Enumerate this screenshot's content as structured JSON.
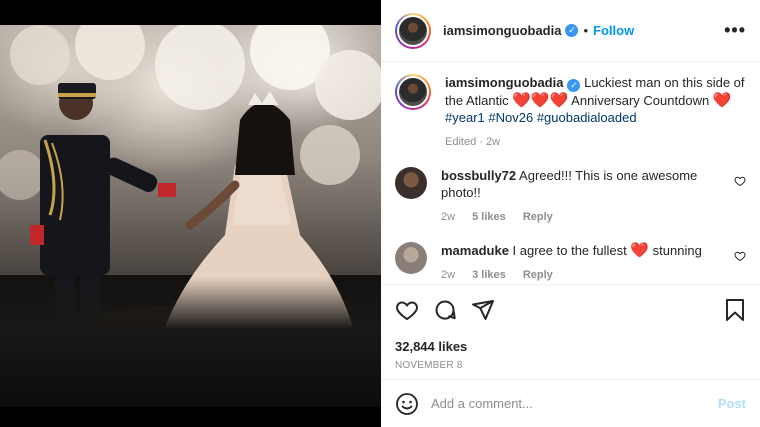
{
  "post": {
    "image_alt": "Wedding anniversary photo",
    "author": "iamsimonguobadia",
    "follow_label": "Follow",
    "more_label": "•••",
    "separator": "•"
  },
  "caption": {
    "user": "iamsimonguobadia",
    "text_part1": "Luckiest man on this side of the Atlantic",
    "hearts1": "❤️❤️❤️",
    "text_part2": "Anniversary Countdown",
    "heart2": "❤️",
    "hashtags": [
      "#year1",
      "#Nov26",
      "#guobadialoaded"
    ],
    "edited_meta": "Edited · 2w"
  },
  "comments": [
    {
      "user": "bossbully72",
      "text": "Agreed!!! This is one awesome photo!!",
      "age": "2w",
      "likes": "5 likes",
      "reply": "Reply",
      "avatar_color": "#3a2f2a"
    },
    {
      "user": "mamaduke",
      "text_before": "I agree to the fullest",
      "heart": "❤️",
      "text_after": "stunning",
      "age": "2w",
      "likes": "3 likes",
      "reply": "Reply",
      "avatar_color": "#8a7f78"
    }
  ],
  "stats": {
    "likes": "32,844 likes",
    "date": "NOVEMBER 8"
  },
  "add_comment": {
    "placeholder": "Add a comment...",
    "post_label": "Post"
  },
  "colors": {
    "accent": "#0095f6",
    "verified": "#3897f0",
    "hashtag": "#00376b",
    "heart": "#ed1c24",
    "muted": "#8e8e8e"
  },
  "icons": {
    "like": "heart-outline-icon",
    "comment": "comment-bubble-icon",
    "share": "paper-plane-icon",
    "save": "bookmark-icon",
    "emoji": "smiley-icon"
  }
}
